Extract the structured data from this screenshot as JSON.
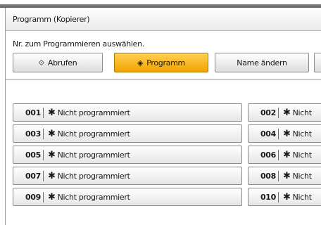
{
  "window": {
    "title": "Programm (Kopierer)"
  },
  "instruction": "Nr. zum Programmieren auswählen.",
  "mode_buttons": [
    {
      "label": "Abrufen",
      "icon": "diamond-arrow-icon",
      "selected": false
    },
    {
      "label": "Programm",
      "icon": "diamond-dot-icon",
      "selected": true
    },
    {
      "label": "Name ändern",
      "icon": "",
      "selected": false
    }
  ],
  "programs": [
    {
      "number": "001",
      "status": "Nicht programmiert"
    },
    {
      "number": "002",
      "status": "Nicht"
    },
    {
      "number": "003",
      "status": "Nicht programmiert"
    },
    {
      "number": "004",
      "status": "Nicht"
    },
    {
      "number": "005",
      "status": "Nicht programmiert"
    },
    {
      "number": "006",
      "status": "Nicht"
    },
    {
      "number": "007",
      "status": "Nicht programmiert"
    },
    {
      "number": "008",
      "status": "Nicht"
    },
    {
      "number": "009",
      "status": "Nicht programmiert"
    },
    {
      "number": "010",
      "status": "Nicht"
    }
  ],
  "colors": {
    "selected_button": "#f5b000",
    "separator": "#c8c8c8"
  }
}
